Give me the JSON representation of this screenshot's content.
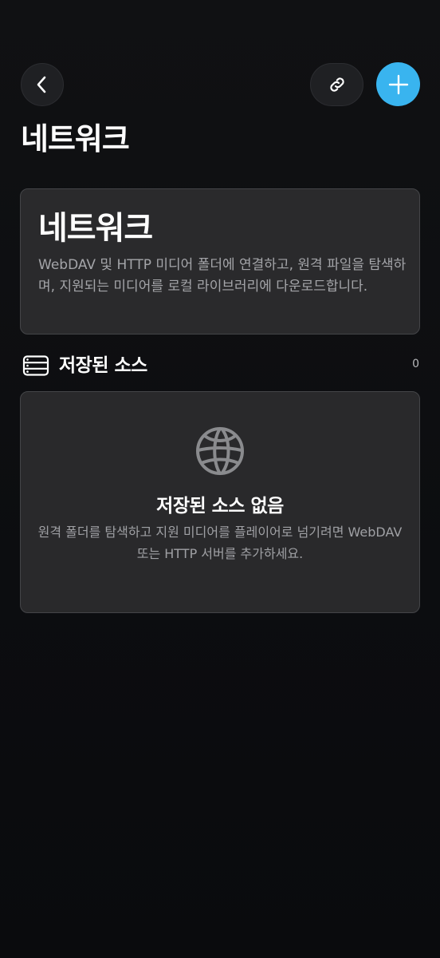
{
  "header": {
    "back_icon": "chevron-left-icon",
    "link_icon": "link-icon",
    "add_icon": "plus-icon",
    "accent_color": "#39b4ef"
  },
  "page": {
    "title": "네트워크"
  },
  "info_card": {
    "title": "네트워크",
    "description": "WebDAV 및 HTTP 미디어 폴더에 연결하고, 원격 파일을 탐색하며, 지원되는 미디어를 로컬 라이브러리에 다운로드합니다."
  },
  "saved_sources": {
    "icon": "server-list-icon",
    "title": "저장된 소스",
    "count": "0"
  },
  "empty_state": {
    "icon": "globe-icon",
    "title": "저장된 소스 없음",
    "description": "원격 폴더를 탐색하고 지원 미디어를 플레이어로 넘기려면 WebDAV 또는 HTTP 서버를 추가하세요."
  }
}
